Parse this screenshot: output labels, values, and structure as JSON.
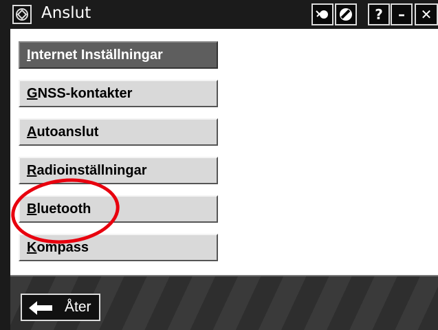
{
  "window": {
    "title": "Anslut"
  },
  "titlebar_buttons": [
    {
      "name": "satellite-icon",
      "label": ""
    },
    {
      "name": "no-entry-icon",
      "label": ""
    },
    {
      "name": "help-button",
      "label": "?"
    },
    {
      "name": "minimize-button",
      "label": "–"
    },
    {
      "name": "close-button",
      "label": "✕"
    }
  ],
  "menu": {
    "items": [
      {
        "accel": "I",
        "rest": "nternet Inställningar",
        "active": true
      },
      {
        "accel": "G",
        "rest": "NSS-kontakter",
        "active": false
      },
      {
        "accel": "A",
        "rest": "utoanslut",
        "active": false
      },
      {
        "accel": "R",
        "rest": "adioinställningar",
        "active": false
      },
      {
        "accel": "B",
        "rest": "luetooth",
        "active": false
      },
      {
        "accel": "K",
        "rest": "ompass",
        "active": false
      }
    ]
  },
  "footer": {
    "back_label": "Åter"
  },
  "colors": {
    "highlight": "#e8000e",
    "active_button": "#5e5e5e",
    "button": "#d9d9d9"
  }
}
